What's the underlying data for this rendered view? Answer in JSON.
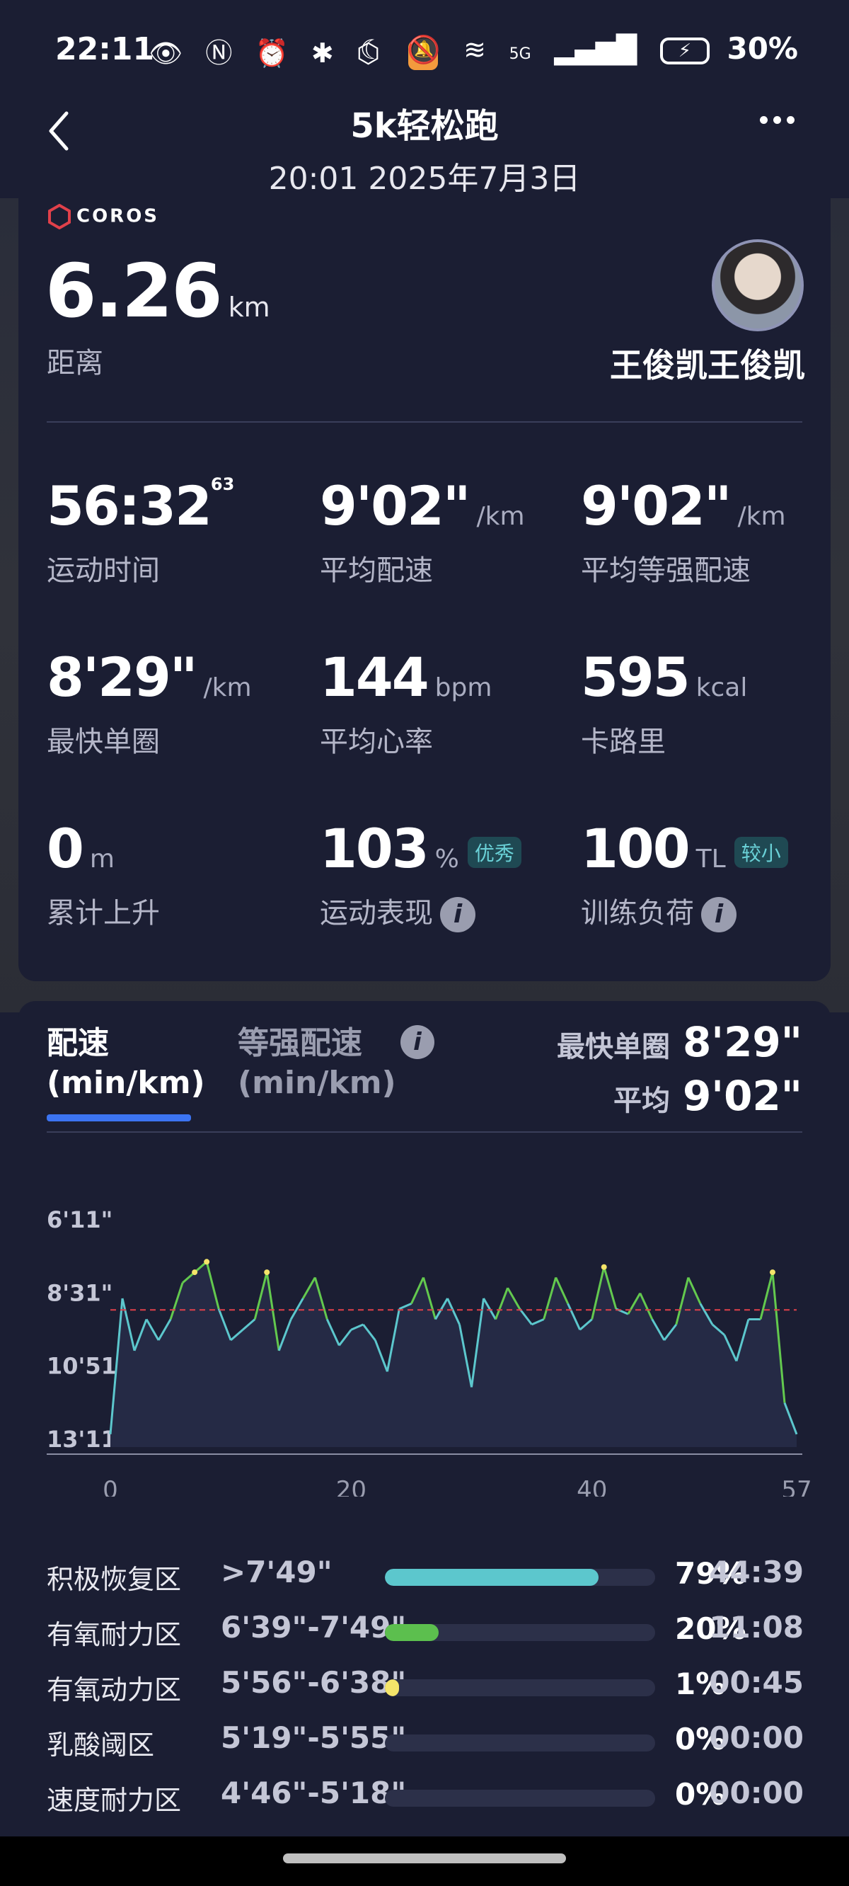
{
  "status_bar": {
    "time": "22:11",
    "network": "5G",
    "battery": "30%"
  },
  "header": {
    "title": "5k轻松跑",
    "datetime": "20:01 2025年7月3日"
  },
  "summary": {
    "brand": "COROS",
    "distance_value": "6.26",
    "distance_unit": "km",
    "distance_label": "距离",
    "username": "王俊凯王俊凯"
  },
  "stats": [
    {
      "value": "56:32",
      "sup": "63",
      "unit": "",
      "label": "运动时间"
    },
    {
      "value": "9'02\"",
      "unit": "/km",
      "label": "平均配速"
    },
    {
      "value": "9'02\"",
      "unit": "/km",
      "label": "平均等强配速"
    },
    {
      "value": "8'29\"",
      "unit": "/km",
      "label": "最快单圈"
    },
    {
      "value": "144",
      "unit": "bpm",
      "label": "平均心率"
    },
    {
      "value": "595",
      "unit": "kcal",
      "label": "卡路里"
    },
    {
      "value": "0",
      "unit": "m",
      "label": "累计上升"
    },
    {
      "value": "103",
      "unit": "%",
      "tag": "优秀",
      "label": "运动表现"
    },
    {
      "value": "100",
      "unit": "TL",
      "tag": "较小",
      "label": "训练负荷"
    }
  ],
  "pace_card": {
    "tab_pace_line1": "配速",
    "tab_pace_line2": "(min/km)",
    "tab_grade_line1": "等强配速",
    "tab_grade_line2": "(min/km)",
    "fastest_label": "最快单圈",
    "fastest_value": "8'29\"",
    "avg_label": "平均",
    "avg_value": "9'02\""
  },
  "chart_data": {
    "type": "line",
    "x": [
      0,
      1,
      2,
      3,
      4,
      5,
      6,
      7,
      8,
      9,
      10,
      11,
      12,
      13,
      14,
      15,
      16,
      17,
      18,
      19,
      20,
      21,
      22,
      23,
      24,
      25,
      26,
      27,
      28,
      29,
      30,
      31,
      32,
      33,
      34,
      35,
      36,
      37,
      38,
      39,
      40,
      41,
      42,
      43,
      44,
      45,
      46,
      47,
      48,
      49,
      50,
      51,
      52,
      53,
      54,
      55,
      56,
      57
    ],
    "y_seconds": [
      780,
      520,
      620,
      560,
      600,
      560,
      490,
      470,
      450,
      540,
      600,
      580,
      560,
      470,
      620,
      560,
      520,
      480,
      560,
      610,
      580,
      570,
      600,
      660,
      540,
      530,
      480,
      560,
      520,
      570,
      690,
      520,
      560,
      500,
      540,
      570,
      560,
      480,
      530,
      580,
      560,
      460,
      540,
      550,
      510,
      560,
      600,
      570,
      480,
      530,
      570,
      590,
      640,
      560,
      560,
      470,
      720,
      780
    ],
    "y_tick_labels": [
      "6'11\"",
      "8'31\"",
      "10'51\"",
      "13'11\""
    ],
    "y_ticks_seconds": [
      371,
      511,
      651,
      791
    ],
    "x_tick_labels": [
      "0",
      "20",
      "40",
      "57"
    ],
    "x_ticks": [
      0,
      20,
      40,
      57
    ],
    "average_seconds": 542,
    "xlim": [
      0,
      57
    ],
    "y_inverted": true,
    "colors": {
      "fast": "#63c94e",
      "normal": "#5cc7cd",
      "avg_line": "#e0404a",
      "peak": "#f4e46a"
    }
  },
  "zones": [
    {
      "name": "积极恢复区",
      "range": ">7'49\"",
      "pct": "79%",
      "fraction": 0.79,
      "time": "44:39",
      "color": "#5cc7cd"
    },
    {
      "name": "有氧耐力区",
      "range": "6'39\"-7'49\"",
      "pct": "20%",
      "fraction": 0.2,
      "time": "11:08",
      "color": "#5cbf4e"
    },
    {
      "name": "有氧动力区",
      "range": "5'56\"-6'38\"",
      "pct": "1%",
      "fraction": 0.01,
      "time": "00:45",
      "color": "#f4e46a"
    },
    {
      "name": "乳酸阈区",
      "range": "5'19\"-5'55\"",
      "pct": "0%",
      "fraction": 0,
      "time": "00:00",
      "color": "#e39a3a"
    },
    {
      "name": "速度耐力区",
      "range": "4'46\"-5'18\"",
      "pct": "0%",
      "fraction": 0,
      "time": "00:00",
      "color": "#e05050"
    }
  ]
}
